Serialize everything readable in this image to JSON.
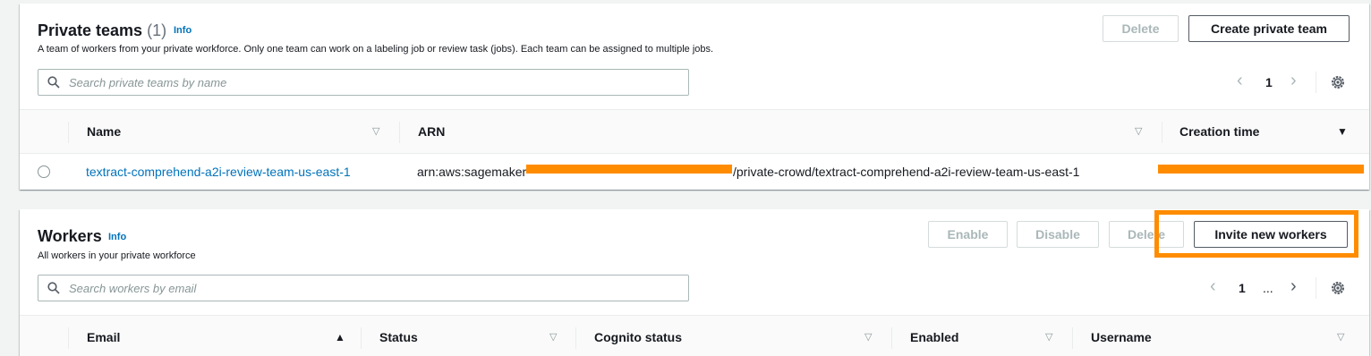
{
  "private_teams": {
    "title": "Private teams",
    "count": "(1)",
    "info": "Info",
    "description": "A team of workers from your private workforce. Only one team can work on a labeling job or review task (jobs). Each team can be assigned to multiple jobs.",
    "delete_label": "Delete",
    "create_label": "Create private team",
    "search_placeholder": "Search private teams by name",
    "page": "1",
    "columns": {
      "name": "Name",
      "arn": "ARN",
      "creation_time": "Creation time"
    },
    "rows": [
      {
        "name": "textract-comprehend-a2i-review-team-us-east-1",
        "arn_prefix": "arn:aws:sagemaker",
        "arn_suffix": "/private-crowd/textract-comprehend-a2i-review-team-us-east-1"
      }
    ]
  },
  "workers": {
    "title": "Workers",
    "info": "Info",
    "description": "All workers in your private workforce",
    "enable_label": "Enable",
    "disable_label": "Disable",
    "delete_label": "Delete",
    "invite_label": "Invite new workers",
    "search_placeholder": "Search workers by email",
    "page": "1",
    "ellipsis": "...",
    "columns": {
      "email": "Email",
      "status": "Status",
      "cognito_status": "Cognito status",
      "enabled": "Enabled",
      "username": "Username"
    }
  },
  "icons": {
    "search": "search-icon",
    "settings": "gear-icon",
    "prev": "chevron-left-icon",
    "next": "chevron-right-icon",
    "sort_neutral": "sort-icon",
    "sort_desc": "caret-down-icon",
    "sort_asc": "caret-up-icon"
  },
  "colors": {
    "link": "#0073bb",
    "redaction": "#ff8c00",
    "disabled_text": "#aab7b8"
  }
}
